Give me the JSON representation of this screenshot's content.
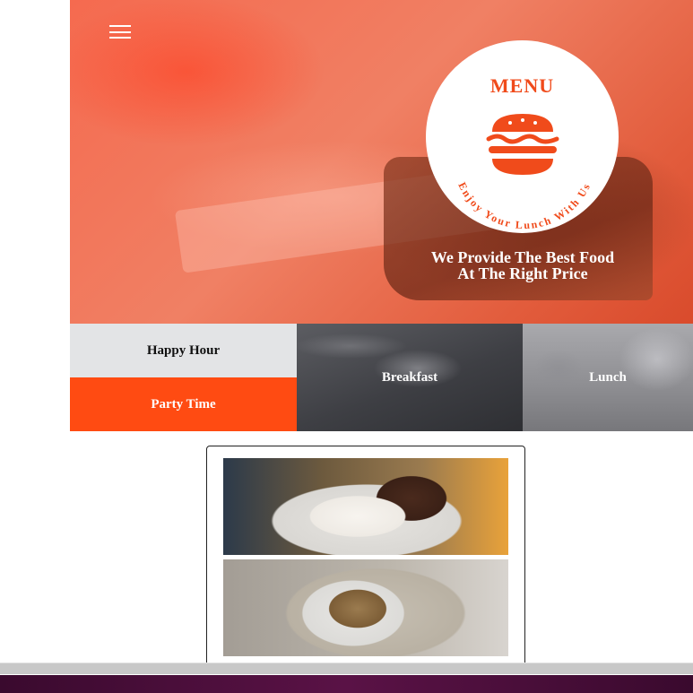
{
  "hero": {
    "menu_icon": "hamburger-menu-icon",
    "badge": {
      "title": "MENU",
      "icon": "burger-icon",
      "curved_text": "Enjoy Your Lunch With Us"
    },
    "tagline_line1": "We Provide The Best Food",
    "tagline_line2": "At The Right Price",
    "accent_color": "#f04b1b"
  },
  "tiles": {
    "happy_hour": "Happy Hour",
    "party_time": "Party Time",
    "breakfast": "Breakfast",
    "lunch": "Lunch"
  },
  "colors": {
    "party_tile": "#ff4b12",
    "happy_tile": "#e3e4e6",
    "footer": "#4a0e3a"
  }
}
